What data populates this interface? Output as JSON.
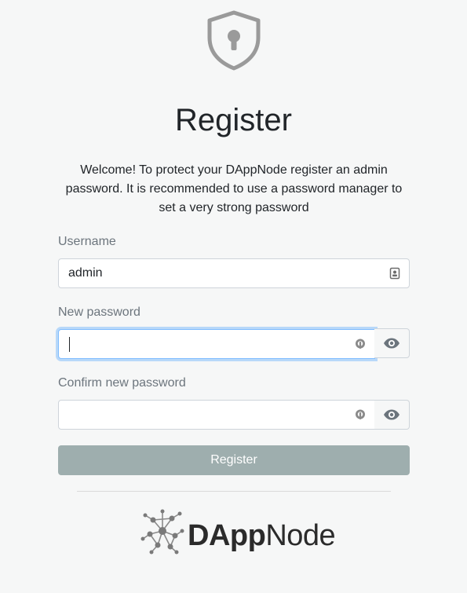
{
  "header": {
    "icon": "shield-keyhole-icon",
    "title": "Register",
    "intro": "Welcome! To protect your DAppNode register an admin password. It is recommended to use a password manager to set a very strong password"
  },
  "form": {
    "username": {
      "label": "Username",
      "value": "admin",
      "icon": "id-card-icon"
    },
    "new_password": {
      "label": "New password",
      "value": "",
      "icon": "password-manager-icon",
      "toggle_icon": "eye-icon"
    },
    "confirm_password": {
      "label": "Confirm new password",
      "value": "",
      "icon": "password-manager-icon",
      "toggle_icon": "eye-icon"
    },
    "submit_label": "Register"
  },
  "footer": {
    "logo_text_bold": "DApp",
    "logo_text_light": "Node"
  },
  "colors": {
    "background": "#f6f7f7",
    "button_disabled": "#9eaeae",
    "focus_border": "#80bdff",
    "label": "#6c757d"
  }
}
